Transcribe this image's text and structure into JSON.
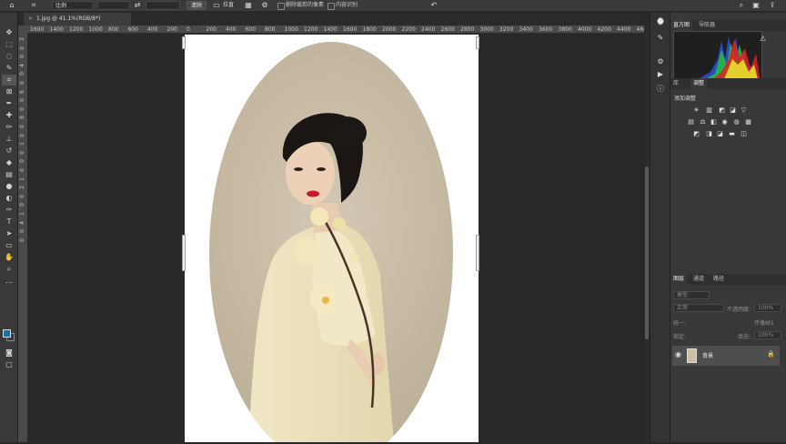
{
  "options_bar": {
    "ratio_label": "比例",
    "swap_icon": "⇄",
    "clear_label": "清除",
    "straighten_label": "拉直",
    "delete_cropped_label": "删除裁剪的像素",
    "content_aware_label": "内容识别",
    "reset_icon": "↶"
  },
  "document": {
    "tab_title": "1.jpg @ 41.1%(RGB/8*)",
    "close_icon": "×"
  },
  "ruler": {
    "h_ticks": [
      "1600",
      "1400",
      "1200",
      "1000",
      "800",
      "600",
      "400",
      "200",
      "0",
      "200",
      "400",
      "600",
      "800",
      "1000",
      "1200",
      "1400",
      "1600",
      "1800",
      "2000",
      "2200",
      "2400",
      "2600",
      "2800",
      "3000",
      "3200",
      "3400",
      "3600",
      "3800",
      "4000",
      "4200",
      "4400",
      "4600"
    ],
    "v_ticks": [
      "2",
      "0",
      "0",
      "4",
      "0",
      "0",
      "6",
      "0",
      "0",
      "8",
      "0",
      "0",
      "1",
      "0",
      "0",
      "0",
      "1",
      "2",
      "0",
      "0",
      "1",
      "4",
      "0",
      "0"
    ]
  },
  "panels": {
    "top_tabs": [
      "直方图",
      "导航器"
    ],
    "mid_tabs": [
      "库",
      "调整"
    ],
    "add_adjustment": "添加调整",
    "layer_tabs": [
      "图层",
      "通道",
      "路径"
    ],
    "kind_placeholder": "类型",
    "blend_mode": "正常",
    "opacity_label": "不透明度:",
    "opacity_value": "100%",
    "unify_label": "统一:",
    "propagate_label": "传播帧1",
    "lock_label": "锁定:",
    "fill_label": "填充:",
    "fill_value": "100%",
    "layer_name": "背景"
  },
  "colors": {
    "foreground": "#1a6fa8",
    "background": "#ffffff",
    "oval_bg": "#c9bda7"
  }
}
